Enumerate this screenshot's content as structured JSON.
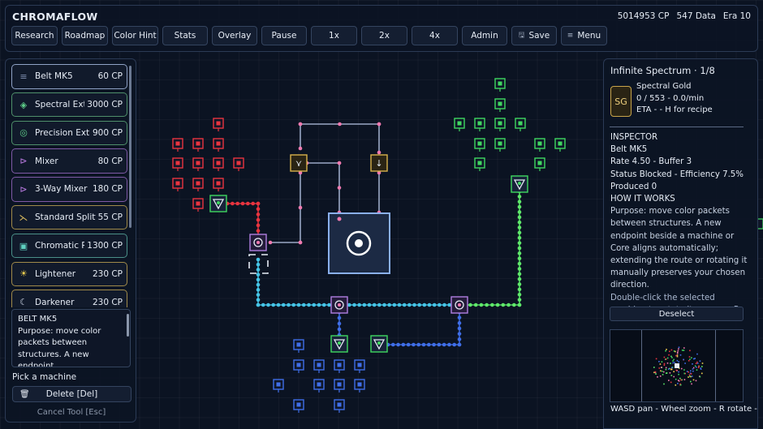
{
  "header": {
    "title": "CHROMAFLOW",
    "cp": "5014953 CP",
    "data": "547 Data",
    "era": "Era 10"
  },
  "toolbar": [
    {
      "label": "Research",
      "w": 56
    },
    {
      "label": "Roadmap",
      "w": 56
    },
    {
      "label": "Color Hint",
      "w": 56
    },
    {
      "label": "Stats",
      "w": 56
    },
    {
      "label": "Overlay",
      "w": 56
    },
    {
      "label": "Pause",
      "w": 56
    },
    {
      "label": "1x",
      "w": 56
    },
    {
      "label": "2x",
      "w": 56
    },
    {
      "label": "4x",
      "w": 56
    },
    {
      "label": "Admin",
      "w": 56
    },
    {
      "label": "Save",
      "w": 56,
      "icon": "save-icon",
      "glyph": "🖫"
    },
    {
      "label": "Menu",
      "w": 56,
      "icon": "menu-icon",
      "glyph": "≡"
    }
  ],
  "machines": [
    {
      "label": "Belt MK5",
      "cost": "60 CP",
      "icon": "belt-icon",
      "glyph": "≡",
      "color": "#7f8fb0",
      "border": "#8fa2c6"
    },
    {
      "label": "Spectral Extr…",
      "cost": "3000 CP",
      "icon": "spectral-extractor-icon",
      "glyph": "◈",
      "color": "#5fd08a",
      "border": "#4f8f6a"
    },
    {
      "label": "Precision Extra…",
      "cost": "900 CP",
      "icon": "precision-extractor-icon",
      "glyph": "◎",
      "color": "#5fd08a",
      "border": "#4f8f6a"
    },
    {
      "label": "Mixer",
      "cost": "80 CP",
      "icon": "mixer-icon",
      "glyph": "⊳",
      "color": "#c07ee8",
      "border": "#7f5aa6"
    },
    {
      "label": "3-Way Mixer",
      "cost": "180 CP",
      "icon": "three-way-mixer-icon",
      "glyph": "⊳",
      "color": "#c07ee8",
      "border": "#7f5aa6"
    },
    {
      "label": "Standard Splitter",
      "cost": "55 CP",
      "icon": "splitter-icon",
      "glyph": "⋋",
      "color": "#e0c060",
      "border": "#a08a4a"
    },
    {
      "label": "Chromatic Re…",
      "cost": "1300 CP",
      "icon": "chromatic-refiner-icon",
      "glyph": "▣",
      "color": "#5fd0c0",
      "border": "#4a8f88"
    },
    {
      "label": "Lightener",
      "cost": "230 CP",
      "icon": "lightener-icon",
      "glyph": "☀",
      "color": "#f0d050",
      "border": "#a08a4a"
    },
    {
      "label": "Darkener",
      "cost": "230 CP",
      "icon": "darkener-icon",
      "glyph": "☾",
      "color": "#d0d8e8",
      "border": "#a08a4a"
    }
  ],
  "infobox": {
    "title": "BELT MK5",
    "text": "Purpose: move color packets between structures. A new endpoint"
  },
  "pick_label": "Pick a machine",
  "delete_label": "Delete  [Del]",
  "cancel_label": "Cancel Tool  [Esc]",
  "right": {
    "title": "Infinite Spectrum · 1/8",
    "badge": "SG",
    "recipe_name": "Spectral Gold",
    "recipe_progress": "0 / 553  -  0.0/min",
    "recipe_eta": "ETA -  - H for recipe",
    "inspector_label": "INSPECTOR",
    "machine": "Belt MK5",
    "rate": "Rate 4.50 - Buffer 3",
    "status": "Status Blocked - Efficiency 7.5%",
    "produced": "Produced 0",
    "how": "HOW IT WORKS",
    "purpose": "Purpose: move color packets between structures. A new endpoint beside a machine or Core aligns automatically; extending the route or rotating it manually preserves your chosen direction.",
    "hint": "Double-click the selected machine to rotate it, or press R.",
    "deselect": "Deselect",
    "controls": "WASD pan - Wheel zoom - R rotate -"
  },
  "colors": {
    "red": "#e8343f",
    "green": "#3fd860",
    "blue": "#3f6ee8",
    "pink": "#f07ab0",
    "cyan": "#45c4e6",
    "lime": "#5ee86a",
    "gold": "#d8b14a",
    "purple": "#b07ee0"
  }
}
